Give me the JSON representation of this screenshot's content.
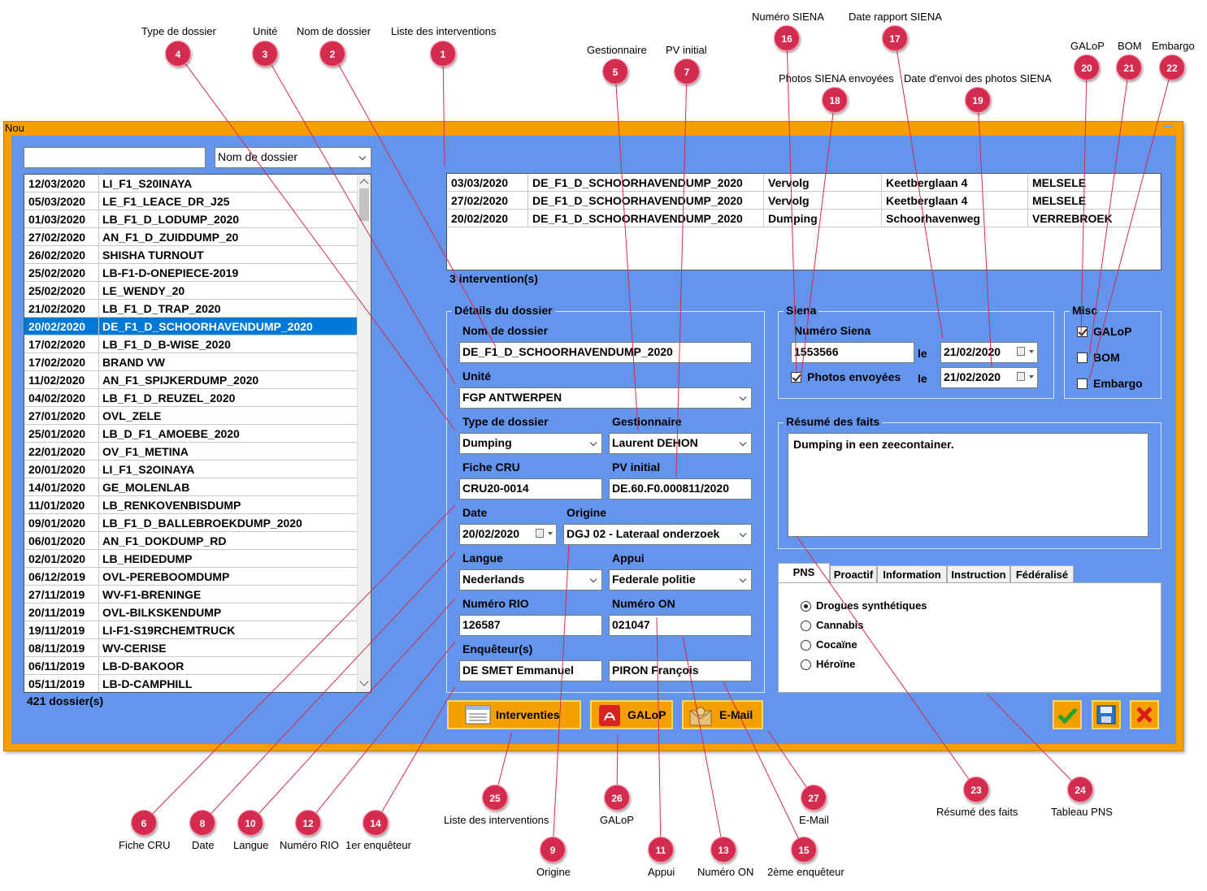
{
  "window": {
    "title": "Nou"
  },
  "search": {
    "value": "",
    "sort_field": "Nom de dossier"
  },
  "dossiers": [
    {
      "date": "12/03/2020",
      "name": "LI_F1_S20INAYA"
    },
    {
      "date": "05/03/2020",
      "name": "LE_F1_LEACE_DR_J25"
    },
    {
      "date": "01/03/2020",
      "name": "LB_F1_D_LODUMP_2020"
    },
    {
      "date": "27/02/2020",
      "name": "AN_F1_D_ZUIDDUMP_20"
    },
    {
      "date": "26/02/2020",
      "name": "SHISHA TURNOUT"
    },
    {
      "date": "25/02/2020",
      "name": "LB-F1-D-ONEPIECE-2019"
    },
    {
      "date": "25/02/2020",
      "name": "LE_WENDY_20"
    },
    {
      "date": "21/02/2020",
      "name": "LB_F1_D_TRAP_2020"
    },
    {
      "date": "20/02/2020",
      "name": "DE_F1_D_SCHOORHAVENDUMP_2020"
    },
    {
      "date": "17/02/2020",
      "name": "LB_F1_D_B-WISE_2020"
    },
    {
      "date": "17/02/2020",
      "name": "BRAND VW"
    },
    {
      "date": "11/02/2020",
      "name": "AN_F1_SPIJKERDUMP_2020"
    },
    {
      "date": "04/02/2020",
      "name": "LB_F1_D_REUZEL_2020"
    },
    {
      "date": "27/01/2020",
      "name": "OVL_ZELE"
    },
    {
      "date": "25/01/2020",
      "name": "LB_D_F1_AMOEBE_2020"
    },
    {
      "date": "22/01/2020",
      "name": "OV_F1_METINA"
    },
    {
      "date": "20/01/2020",
      "name": "LI_F1_S2OINAYA"
    },
    {
      "date": "14/01/2020",
      "name": "GE_MOLENLAB"
    },
    {
      "date": "11/01/2020",
      "name": "LB_RENKOVENBISDUMP"
    },
    {
      "date": "09/01/2020",
      "name": "LB_F1_D_BALLEBROEKDUMP_2020"
    },
    {
      "date": "06/01/2020",
      "name": "AN_F1_DOKDUMP_RD"
    },
    {
      "date": "02/01/2020",
      "name": "LB_HEIDEDUMP"
    },
    {
      "date": "06/12/2019",
      "name": "OVL-PEREBOOMDUMP"
    },
    {
      "date": "27/11/2019",
      "name": "WV-F1-BRENINGE"
    },
    {
      "date": "20/11/2019",
      "name": "OVL-BILKSKENDUMP"
    },
    {
      "date": "19/11/2019",
      "name": "LI-F1-S19RCHEMTRUCK"
    },
    {
      "date": "08/11/2019",
      "name": "WV-CERISE"
    },
    {
      "date": "06/11/2019",
      "name": "LB-D-BAKOOR"
    },
    {
      "date": "05/11/2019",
      "name": "LB-D-CAMPHILL"
    }
  ],
  "dossier_count": "421 dossier(s)",
  "interventions": [
    [
      "03/03/2020",
      "DE_F1_D_SCHOORHAVENDUMP_2020",
      "Vervolg",
      "Keetberglaan 4",
      "MELSELE"
    ],
    [
      "27/02/2020",
      "DE_F1_D_SCHOORHAVENDUMP_2020",
      "Vervolg",
      "Keetberglaan 4",
      "MELSELE"
    ],
    [
      "20/02/2020",
      "DE_F1_D_SCHOORHAVENDUMP_2020",
      "Dumping",
      "Schoorhavenweg",
      "VERREBROEK"
    ]
  ],
  "intervention_count": "3 intervention(s)",
  "details": {
    "title": "Détails du dossier",
    "nom_label": "Nom de dossier",
    "nom": "DE_F1_D_SCHOORHAVENDUMP_2020",
    "unite_label": "Unité",
    "unite": "FGP ANTWERPEN",
    "type_label": "Type de dossier",
    "type": "Dumping",
    "gest_label": "Gestionnaire",
    "gest": "Laurent DEHON",
    "cru_label": "Fiche CRU",
    "cru": "CRU20-0014",
    "pv_label": "PV initial",
    "pv": "DE.60.F0.000811/2020",
    "date_label": "Date",
    "date": "20/02/2020",
    "origine_label": "Origine",
    "origine": "DGJ 02 - Lateraal onderzoek",
    "langue_label": "Langue",
    "langue": "Nederlands",
    "appui_label": "Appui",
    "appui": "Federale politie",
    "rio_label": "Numéro RIO",
    "rio": "126587",
    "on_label": "Numéro ON",
    "on": "021047",
    "enq_label": "Enquêteur(s)",
    "enq1": "DE SMET Emmanuel",
    "enq2": "PIRON François"
  },
  "siena": {
    "title": "Siena",
    "num_label": "Numéro Siena",
    "num": "1553566",
    "le1": "le",
    "date1": "21/02/2020",
    "photos_label": "Photos envoyées",
    "le2": "le",
    "date2": "21/02/2020"
  },
  "misc": {
    "title": "Misc",
    "galop": "GALoP",
    "bom": "BOM",
    "embargo": "Embargo"
  },
  "resume": {
    "title": "Résumé des faits",
    "text": "Dumping in een zeecontainer."
  },
  "tabs": [
    "PNS",
    "Proactif",
    "Information",
    "Instruction",
    "Fédéralisé"
  ],
  "pns_options": [
    "Drogues synthétiques",
    "Cannabis",
    "Cocaïne",
    "Héroïne"
  ],
  "buttons": {
    "interventies": "Interventies",
    "galop": "GALoP",
    "email": "E-Mail"
  },
  "markers": [
    "1",
    "2",
    "3",
    "4",
    "5",
    "6",
    "7",
    "8",
    "9",
    "10",
    "11",
    "12",
    "13",
    "14",
    "15",
    "16",
    "17",
    "18",
    "19",
    "20",
    "21",
    "22",
    "23",
    "24",
    "25",
    "26",
    "27"
  ],
  "callouts": {
    "c1": "Liste des interventions",
    "c2": "Nom de dossier",
    "c3": "Unité",
    "c4": "Type de dossier",
    "c5": "Gestionnaire",
    "c6": "Fiche CRU",
    "c7": "PV initial",
    "c8": "Date",
    "c9": "Origine",
    "c10": "Langue",
    "c11": "Appui",
    "c12": "Numéro RIO",
    "c13": "Numéro ON",
    "c14": "1er enquêteur",
    "c15": "2ème enquêteur",
    "c16": "Numéro SIENA",
    "c17": "Date rapport SIENA",
    "c18": "Photos SIENA envoyées",
    "c19": "Date d'envoi des photos SIENA",
    "c20": "GALoP",
    "c21": "BOM",
    "c22": "Embargo",
    "c23": "Résumé des faits",
    "c24": "Tableau PNS",
    "c25": "Liste des interventions",
    "c26": "GALoP",
    "c27": "E-Mail"
  }
}
